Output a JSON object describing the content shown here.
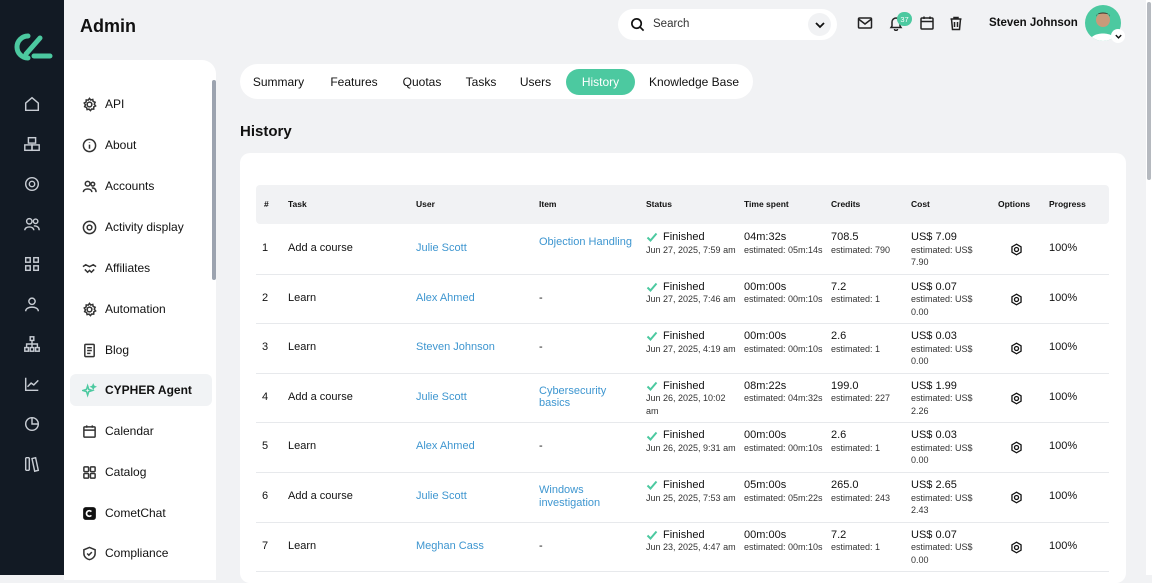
{
  "app": {
    "title": "Admin"
  },
  "rail": {
    "icons": [
      "home-icon",
      "cube-group-icon",
      "target-icon",
      "users-icon",
      "grid-icon",
      "user-icon",
      "hierarchy-icon",
      "chart-line-icon",
      "pie-chart-icon",
      "library-icon"
    ]
  },
  "sidebar": {
    "items": [
      {
        "label": "API",
        "icon": "gear-icon"
      },
      {
        "label": "About",
        "icon": "info-icon"
      },
      {
        "label": "Accounts",
        "icon": "users-icon"
      },
      {
        "label": "Activity display",
        "icon": "target-icon"
      },
      {
        "label": "Affiliates",
        "icon": "handshake-icon"
      },
      {
        "label": "Automation",
        "icon": "gear-icon"
      },
      {
        "label": "Blog",
        "icon": "document-icon"
      },
      {
        "label": "CYPHER Agent",
        "icon": "sparkle-icon",
        "active": true
      },
      {
        "label": "Calendar",
        "icon": "calendar-icon"
      },
      {
        "label": "Catalog",
        "icon": "grid-icon"
      },
      {
        "label": "CometChat",
        "icon": "chat-icon"
      },
      {
        "label": "Compliance",
        "icon": "shield-icon"
      }
    ]
  },
  "header": {
    "search_placeholder": "Search",
    "notifications_count": "37",
    "user_name": "Steven Johnson"
  },
  "tabs": [
    {
      "label": "Summary"
    },
    {
      "label": "Features"
    },
    {
      "label": "Quotas"
    },
    {
      "label": "Tasks"
    },
    {
      "label": "Users"
    },
    {
      "label": "History",
      "active": true
    },
    {
      "label": "Knowledge Base"
    }
  ],
  "page": {
    "title": "History"
  },
  "table": {
    "columns": [
      "#",
      "Task",
      "User",
      "Item",
      "Status",
      "Time spent",
      "Credits",
      "Cost",
      "Options",
      "Progress"
    ],
    "rows": [
      {
        "num": "1",
        "task": "Add a course",
        "user": "Julie Scott",
        "item": "Objection Handling",
        "status": "Finished",
        "date": "Jun 27, 2025, 7:59 am",
        "time": "04m:32s",
        "time_est": "estimated: 05m:14s",
        "credits": "708.5",
        "credits_est": "estimated: 790",
        "cost": "US$ 7.09",
        "cost_est": "estimated: US$ 7.90",
        "progress": "100%"
      },
      {
        "num": "2",
        "task": "Learn",
        "user": "Alex Ahmed",
        "item": "-",
        "status": "Finished",
        "date": "Jun 27, 2025, 7:46 am",
        "time": "00m:00s",
        "time_est": "estimated: 00m:10s",
        "credits": "7.2",
        "credits_est": "estimated: 1",
        "cost": "US$ 0.07",
        "cost_est": "estimated: US$ 0.00",
        "progress": "100%"
      },
      {
        "num": "3",
        "task": "Learn",
        "user": "Steven Johnson",
        "item": "-",
        "status": "Finished",
        "date": "Jun 27, 2025, 4:19 am",
        "time": "00m:00s",
        "time_est": "estimated: 00m:10s",
        "credits": "2.6",
        "credits_est": "estimated: 1",
        "cost": "US$ 0.03",
        "cost_est": "estimated: US$ 0.00",
        "progress": "100%"
      },
      {
        "num": "4",
        "task": "Add a course",
        "user": "Julie Scott",
        "item": "Cybersecurity basics",
        "status": "Finished",
        "date": "Jun 26, 2025, 10:02 am",
        "time": "08m:22s",
        "time_est": "estimated: 04m:32s",
        "credits": "199.0",
        "credits_est": "estimated: 227",
        "cost": "US$ 1.99",
        "cost_est": "estimated: US$ 2.26",
        "progress": "100%"
      },
      {
        "num": "5",
        "task": "Learn",
        "user": "Alex Ahmed",
        "item": "-",
        "status": "Finished",
        "date": "Jun 26, 2025, 9:31 am",
        "time": "00m:00s",
        "time_est": "estimated: 00m:10s",
        "credits": "2.6",
        "credits_est": "estimated: 1",
        "cost": "US$ 0.03",
        "cost_est": "estimated: US$ 0.00",
        "progress": "100%"
      },
      {
        "num": "6",
        "task": "Add a course",
        "user": "Julie Scott",
        "item": "Windows investigation",
        "status": "Finished",
        "date": "Jun 25, 2025, 7:53 am",
        "time": "05m:00s",
        "time_est": "estimated: 05m:22s",
        "credits": "265.0",
        "credits_est": "estimated: 243",
        "cost": "US$ 2.65",
        "cost_est": "estimated: US$ 2.43",
        "progress": "100%"
      },
      {
        "num": "7",
        "task": "Learn",
        "user": "Meghan Cass",
        "item": "-",
        "status": "Finished",
        "date": "Jun 23, 2025, 4:47 am",
        "time": "00m:00s",
        "time_est": "estimated: 00m:10s",
        "credits": "7.2",
        "credits_est": "estimated: 1",
        "cost": "US$ 0.07",
        "cost_est": "estimated: US$ 0.00",
        "progress": "100%"
      }
    ]
  }
}
